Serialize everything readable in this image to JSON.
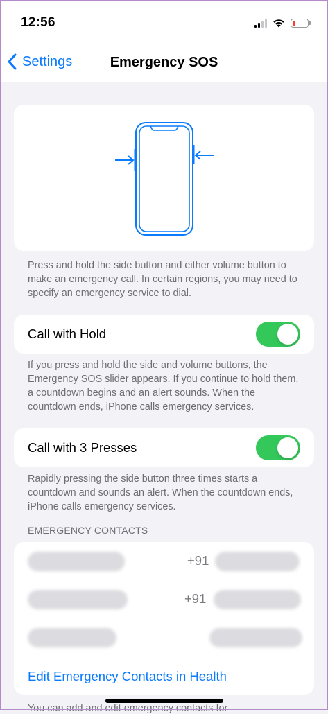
{
  "status_bar": {
    "time": "12:56",
    "battery_color": "#ff3b30"
  },
  "nav": {
    "back_label": "Settings",
    "title": "Emergency SOS"
  },
  "illustration": {
    "footer": "Press and hold the side button and either volume button to make an emergency call. In certain regions, you may need to specify an emergency service to dial.",
    "accent_color": "#0a7aff"
  },
  "call_with_hold": {
    "label": "Call with Hold",
    "enabled": true,
    "footer": "If you press and hold the side and volume buttons, the Emergency SOS slider appears. If you continue to hold them, a countdown begins and an alert sounds. When the countdown ends, iPhone calls emergency services."
  },
  "call_with_3_presses": {
    "label": "Call with 3 Presses",
    "enabled": true,
    "footer": "Rapidly pressing the side button three times starts a countdown and sounds an alert. When the countdown ends, iPhone calls emergency services."
  },
  "emergency_contacts": {
    "header": "EMERGENCY CONTACTS",
    "contacts": [
      {
        "phone_prefix": "+91"
      },
      {
        "phone_prefix": "+91"
      },
      {
        "phone_prefix": ""
      }
    ],
    "edit_link": "Edit Emergency Contacts in Health",
    "footer_partial": "You can add and edit emergency contacts for"
  },
  "colors": {
    "toggle_on": "#34c759",
    "link": "#0a7aff",
    "background": "#f2f2f7"
  }
}
